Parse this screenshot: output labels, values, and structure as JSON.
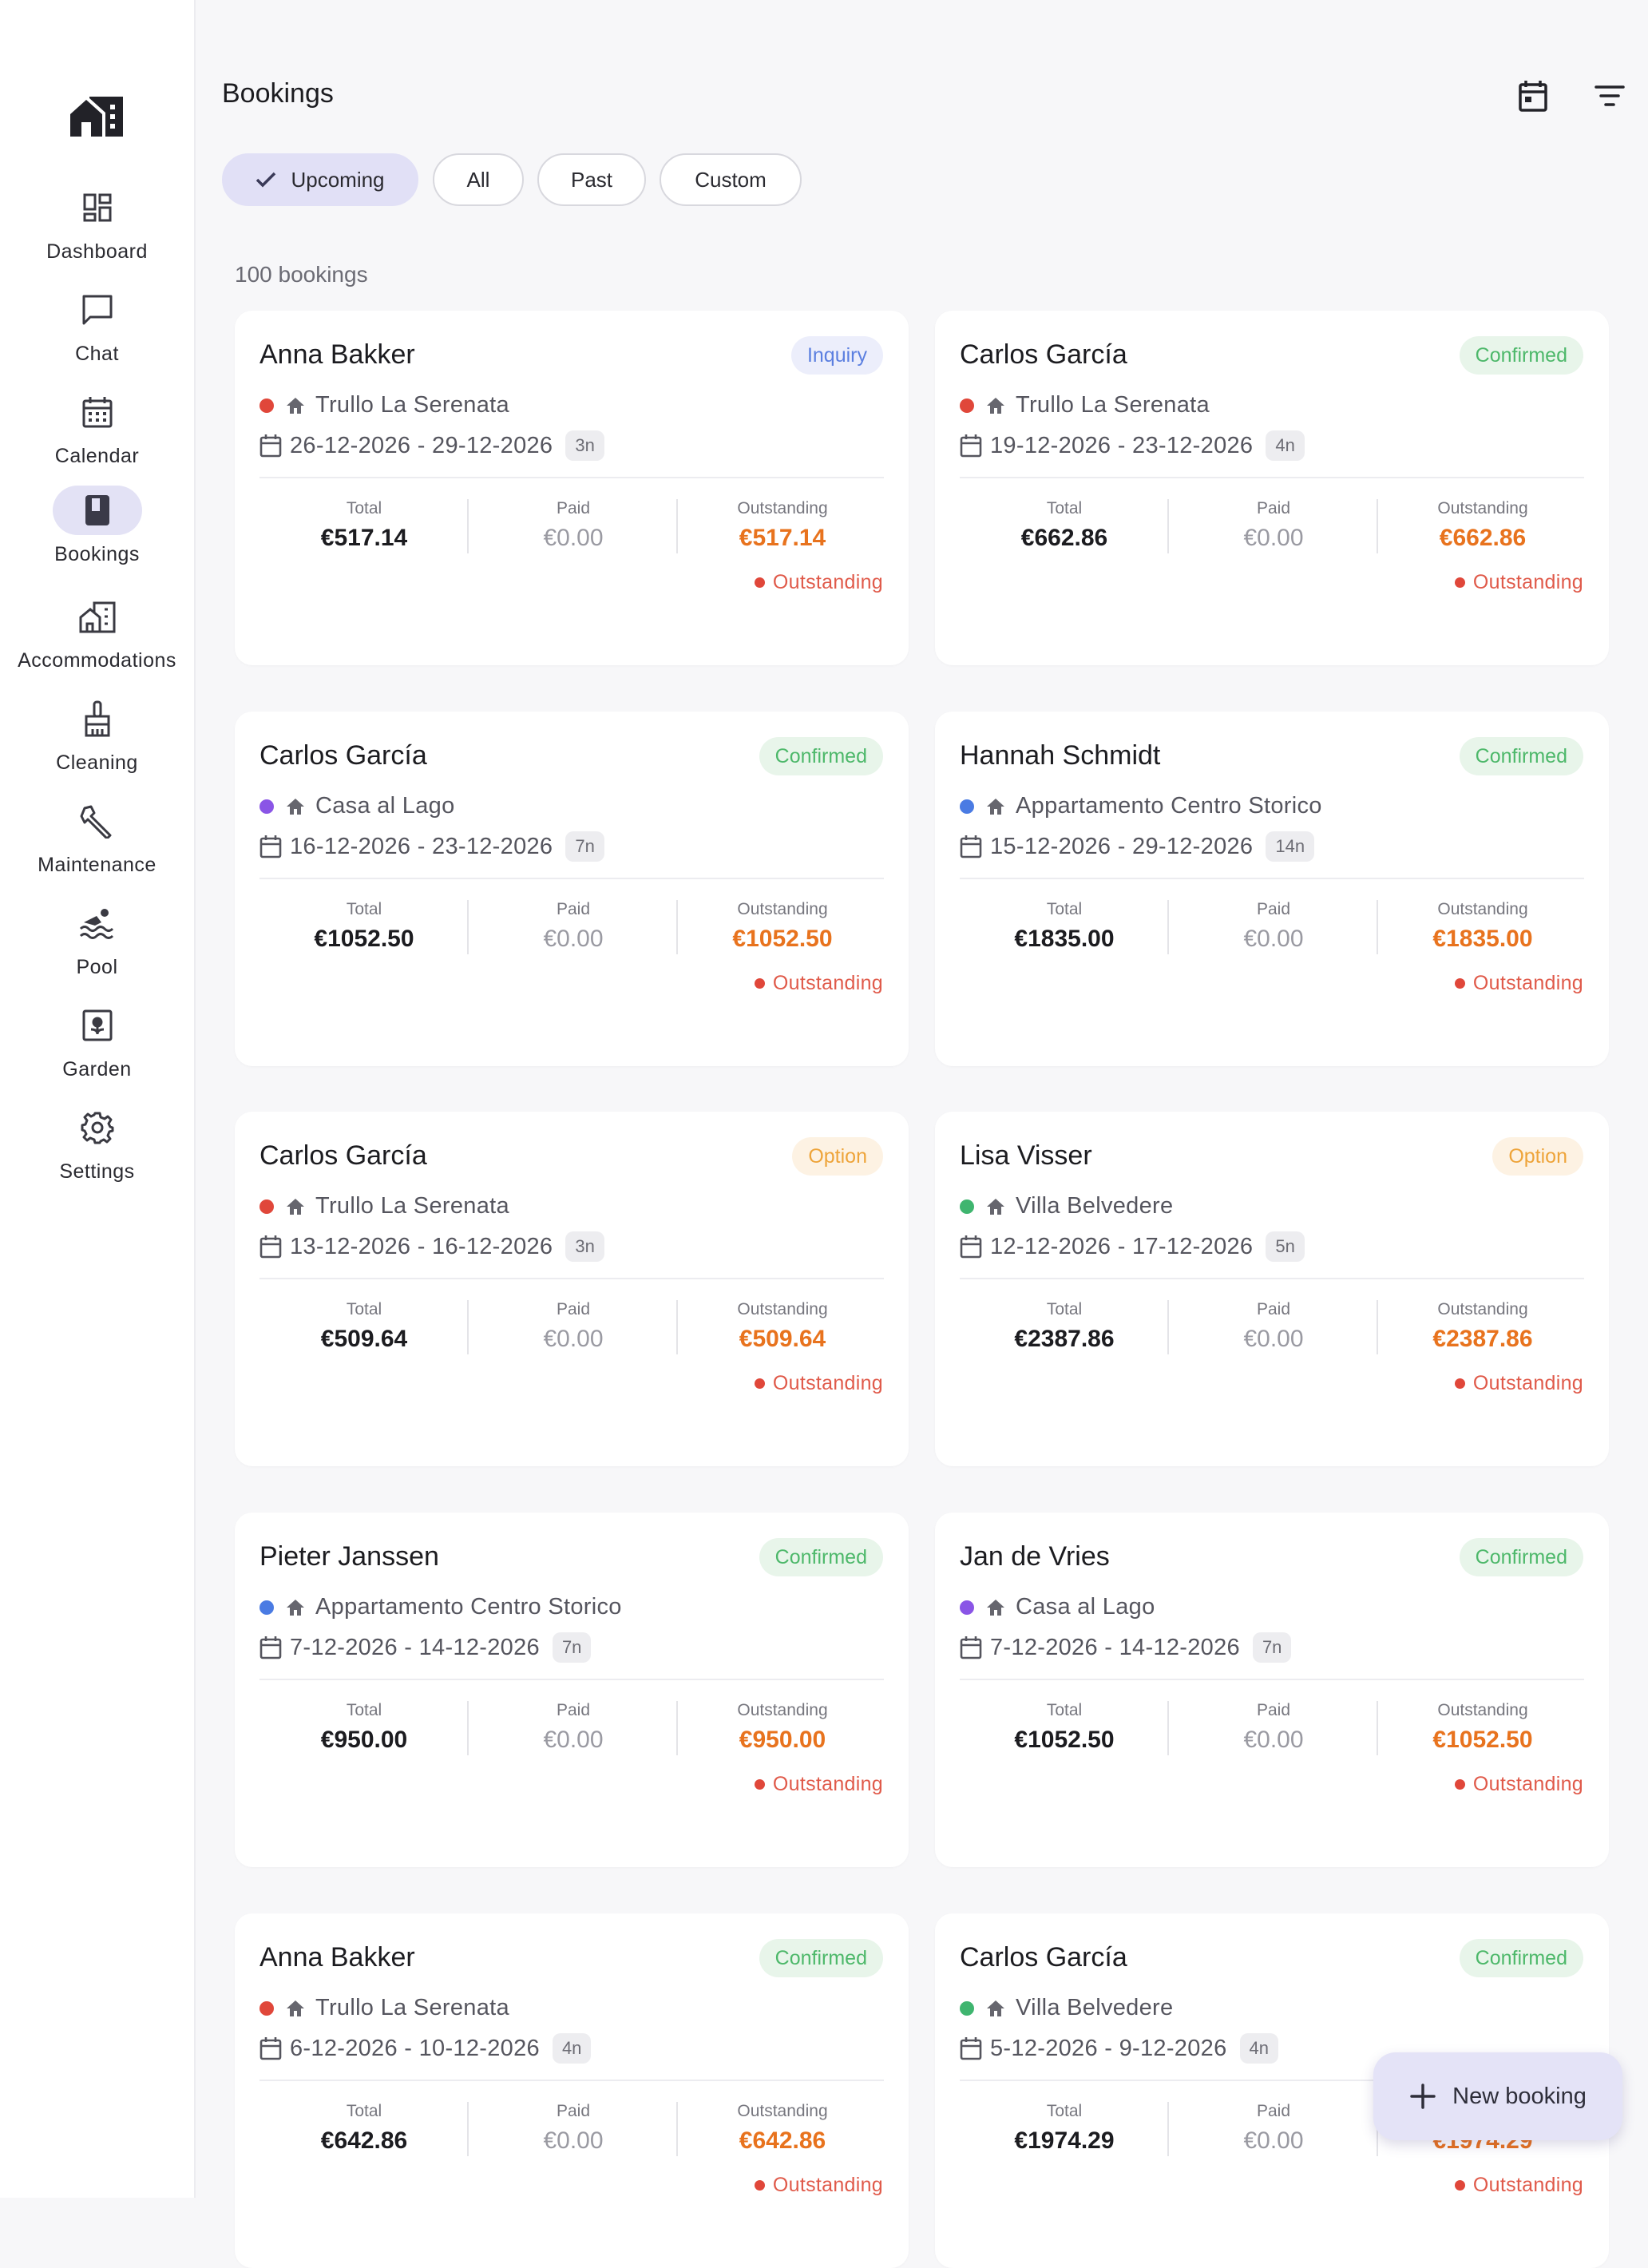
{
  "sidebar": {
    "items": [
      {
        "label": "Dashboard",
        "icon": "dashboard-icon"
      },
      {
        "label": "Chat",
        "icon": "chat-icon"
      },
      {
        "label": "Calendar",
        "icon": "calendar-icon"
      },
      {
        "label": "Bookings",
        "icon": "book-icon"
      },
      {
        "label": "Accommodations",
        "icon": "buildings-icon"
      },
      {
        "label": "Cleaning",
        "icon": "broom-icon"
      },
      {
        "label": "Maintenance",
        "icon": "wrench-icon"
      },
      {
        "label": "Pool",
        "icon": "pool-icon"
      },
      {
        "label": "Garden",
        "icon": "garden-icon"
      },
      {
        "label": "Settings",
        "icon": "gear-icon"
      }
    ],
    "active": "Bookings"
  },
  "header": {
    "title": "Bookings"
  },
  "filters": [
    "Upcoming",
    "All",
    "Past",
    "Custom"
  ],
  "selected_filter": "Upcoming",
  "count_label": "100 bookings",
  "labels": {
    "total": "Total",
    "paid": "Paid",
    "outstanding": "Outstanding"
  },
  "colors": {
    "accent": "#e1e0f6",
    "trullo": "#e0473a",
    "casa": "#8a55e6",
    "appartamento": "#4a7be3",
    "villa": "#3fb56f"
  },
  "bookings": [
    {
      "guest": "Anna Bakker",
      "status": "Inquiry",
      "status_kind": "inquiry",
      "property": "Trullo La Serenata",
      "color": "#e0473a",
      "dates": "26-12-2026 - 29-12-2026",
      "nights": "3n",
      "total": "€517.14",
      "paid": "€0.00",
      "outstanding": "€517.14",
      "pay_status": "Outstanding"
    },
    {
      "guest": "Carlos García",
      "status": "Confirmed",
      "status_kind": "confirmed",
      "property": "Trullo La Serenata",
      "color": "#e0473a",
      "dates": "19-12-2026 - 23-12-2026",
      "nights": "4n",
      "total": "€662.86",
      "paid": "€0.00",
      "outstanding": "€662.86",
      "pay_status": "Outstanding"
    },
    {
      "guest": "Carlos García",
      "status": "Confirmed",
      "status_kind": "confirmed",
      "property": "Casa al Lago",
      "color": "#8a55e6",
      "dates": "16-12-2026 - 23-12-2026",
      "nights": "7n",
      "total": "€1052.50",
      "paid": "€0.00",
      "outstanding": "€1052.50",
      "pay_status": "Outstanding"
    },
    {
      "guest": "Hannah Schmidt",
      "status": "Confirmed",
      "status_kind": "confirmed",
      "property": "Appartamento Centro Storico",
      "color": "#4a7be3",
      "dates": "15-12-2026 - 29-12-2026",
      "nights": "14n",
      "total": "€1835.00",
      "paid": "€0.00",
      "outstanding": "€1835.00",
      "pay_status": "Outstanding"
    },
    {
      "guest": "Carlos García",
      "status": "Option",
      "status_kind": "option",
      "property": "Trullo La Serenata",
      "color": "#e0473a",
      "dates": "13-12-2026 - 16-12-2026",
      "nights": "3n",
      "total": "€509.64",
      "paid": "€0.00",
      "outstanding": "€509.64",
      "pay_status": "Outstanding"
    },
    {
      "guest": "Lisa Visser",
      "status": "Option",
      "status_kind": "option",
      "property": "Villa Belvedere",
      "color": "#3fb56f",
      "dates": "12-12-2026 - 17-12-2026",
      "nights": "5n",
      "total": "€2387.86",
      "paid": "€0.00",
      "outstanding": "€2387.86",
      "pay_status": "Outstanding"
    },
    {
      "guest": "Pieter Janssen",
      "status": "Confirmed",
      "status_kind": "confirmed",
      "property": "Appartamento Centro Storico",
      "color": "#4a7be3",
      "dates": "7-12-2026 - 14-12-2026",
      "nights": "7n",
      "total": "€950.00",
      "paid": "€0.00",
      "outstanding": "€950.00",
      "pay_status": "Outstanding"
    },
    {
      "guest": "Jan de Vries",
      "status": "Confirmed",
      "status_kind": "confirmed",
      "property": "Casa al Lago",
      "color": "#8a55e6",
      "dates": "7-12-2026 - 14-12-2026",
      "nights": "7n",
      "total": "€1052.50",
      "paid": "€0.00",
      "outstanding": "€1052.50",
      "pay_status": "Outstanding"
    },
    {
      "guest": "Anna Bakker",
      "status": "Confirmed",
      "status_kind": "confirmed",
      "property": "Trullo La Serenata",
      "color": "#e0473a",
      "dates": "6-12-2026 - 10-12-2026",
      "nights": "4n",
      "total": "€642.86",
      "paid": "€0.00",
      "outstanding": "€642.86",
      "pay_status": "Outstanding"
    },
    {
      "guest": "Carlos García",
      "status": "Confirmed",
      "status_kind": "confirmed",
      "property": "Villa Belvedere",
      "color": "#3fb56f",
      "dates": "5-12-2026 - 9-12-2026",
      "nights": "4n",
      "total": "€1974.29",
      "paid": "€0.00",
      "outstanding": "€1974.29",
      "pay_status": "Outstanding"
    }
  ],
  "fab": {
    "label": "New booking",
    "icon": "plus-icon"
  }
}
